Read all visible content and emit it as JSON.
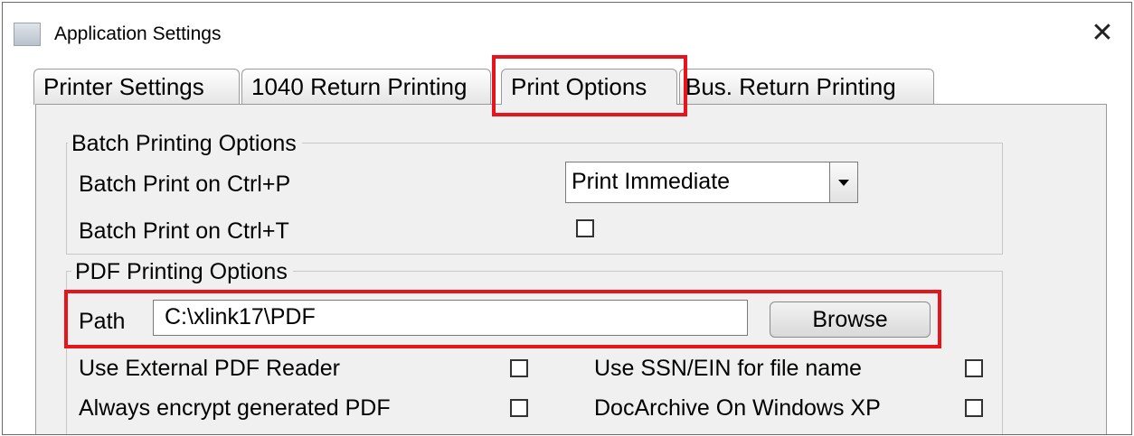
{
  "window": {
    "title": "Application Settings",
    "close_glyph": "✕"
  },
  "tabs": [
    {
      "label": "Printer Settings",
      "active": false
    },
    {
      "label": "1040 Return Printing",
      "active": false
    },
    {
      "label": "Print Options",
      "active": true
    },
    {
      "label": "Bus. Return Printing",
      "active": false
    }
  ],
  "batch_group": {
    "title": "Batch Printing Options",
    "ctrl_p_label": "Batch Print on Ctrl+P",
    "ctrl_p_value": "Print Immediate",
    "ctrl_t_label": "Batch Print on Ctrl+T",
    "ctrl_t_checked": false
  },
  "pdf_group": {
    "title": "PDF Printing Options",
    "path_label": "Path",
    "path_value": "C:\\xlink17\\PDF",
    "browse_label": "Browse",
    "options": [
      {
        "label": "Use External PDF Reader",
        "checked": false
      },
      {
        "label": "Use SSN/EIN for file name",
        "checked": false
      },
      {
        "label": "Always encrypt generated PDF",
        "checked": false
      },
      {
        "label": "DocArchive On Windows XP",
        "checked": false
      }
    ]
  },
  "colors": {
    "highlight": "#e8141b",
    "panel_bg": "#f0f0f0"
  },
  "icons": [
    "app-icon",
    "close-icon",
    "dropdown-arrow-icon"
  ]
}
